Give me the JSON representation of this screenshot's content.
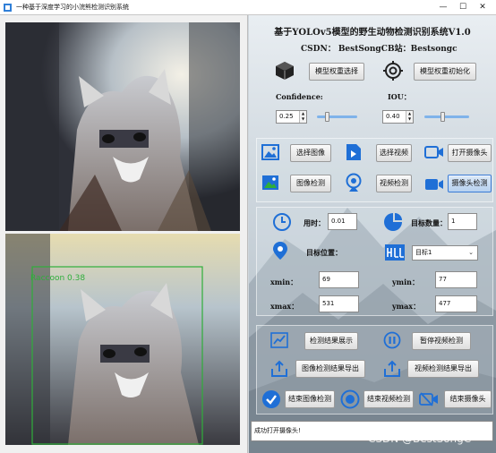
{
  "window": {
    "title": "一种基于深度学习的小浣熊检测识别系统",
    "controls": [
      "—",
      "☐",
      "✕"
    ]
  },
  "detection_overlay": {
    "label": "Raccoon 0.38",
    "color": "#2fae3a"
  },
  "header": {
    "title": "基于YOLOv5模型的野生动物检测识别系统V1.0",
    "csdn": "CSDN： BestSongC",
    "bilibili": "B站：Bestsongc"
  },
  "model": {
    "select_button": "模型权重选择",
    "init_button": "模型权重初始化"
  },
  "params": {
    "confidence_label": "Confidence:",
    "confidence_value": "0.25",
    "confidence_fraction": 0.25,
    "iou_label": "IOU：",
    "iou_value": "0.40",
    "iou_fraction": 0.4
  },
  "actions": {
    "select_image": "选择图像",
    "select_video": "选择视频",
    "open_camera": "打开摄像头",
    "image_detect": "图像检测",
    "video_detect": "视频检测",
    "camera_detect": "摄像头检测"
  },
  "results": {
    "time_label": "用时：",
    "time_value": "0.01",
    "count_label": "目标数量：",
    "count_value": "1",
    "position_label": "目标位置：",
    "target_select": "目标1",
    "xmin_label": "xmin：",
    "xmin_value": "69",
    "ymin_label": "ymin：",
    "ymin_value": "77",
    "xmax_label": "xmax：",
    "xmax_value": "531",
    "ymax_label": "ymax：",
    "ymax_value": "477"
  },
  "bottom_actions": {
    "show_results": "检测结果展示",
    "pause_video": "暂停视频检测",
    "export_image": "图像检测结果导出",
    "export_video": "视频检测结果导出",
    "end_image": "结束图像检测",
    "end_video": "结束视频检测",
    "end_camera": "结束摄像头"
  },
  "status": {
    "message": "成功打开摄像头!"
  },
  "watermark": "CSDN @BestSongC",
  "colors": {
    "accent_blue": "#1f6fd6",
    "detection_green": "#2fae3a"
  }
}
